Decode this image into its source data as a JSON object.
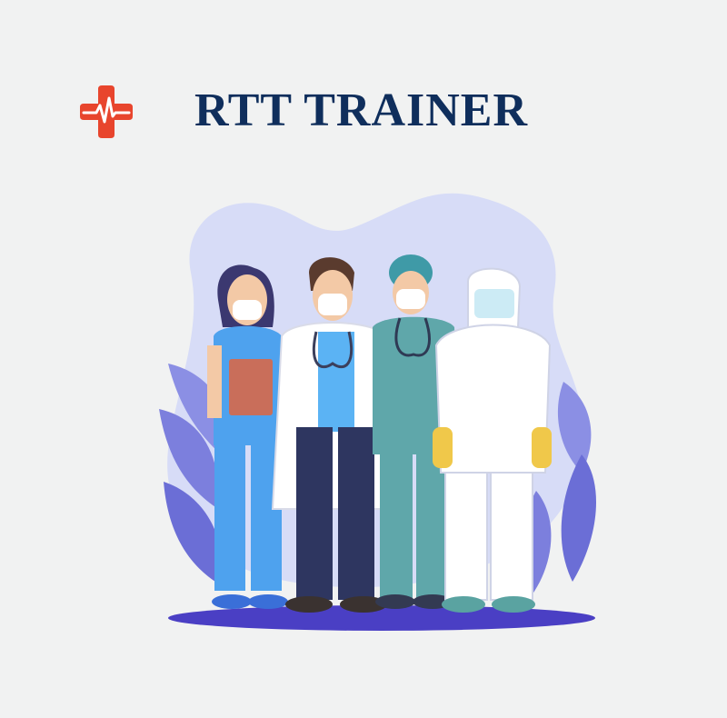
{
  "app": {
    "title": "RTT TRAINER",
    "logo_icon": "medical-cross-heartbeat-icon",
    "illustration": "medical-staff-illustration"
  },
  "colors": {
    "background": "#f1f2f2",
    "title": "#0f2e5c",
    "logo": "#e8452d",
    "blob": "#d7dcf7",
    "leaves": "#7d80df",
    "ground": "#4a3fc4"
  }
}
